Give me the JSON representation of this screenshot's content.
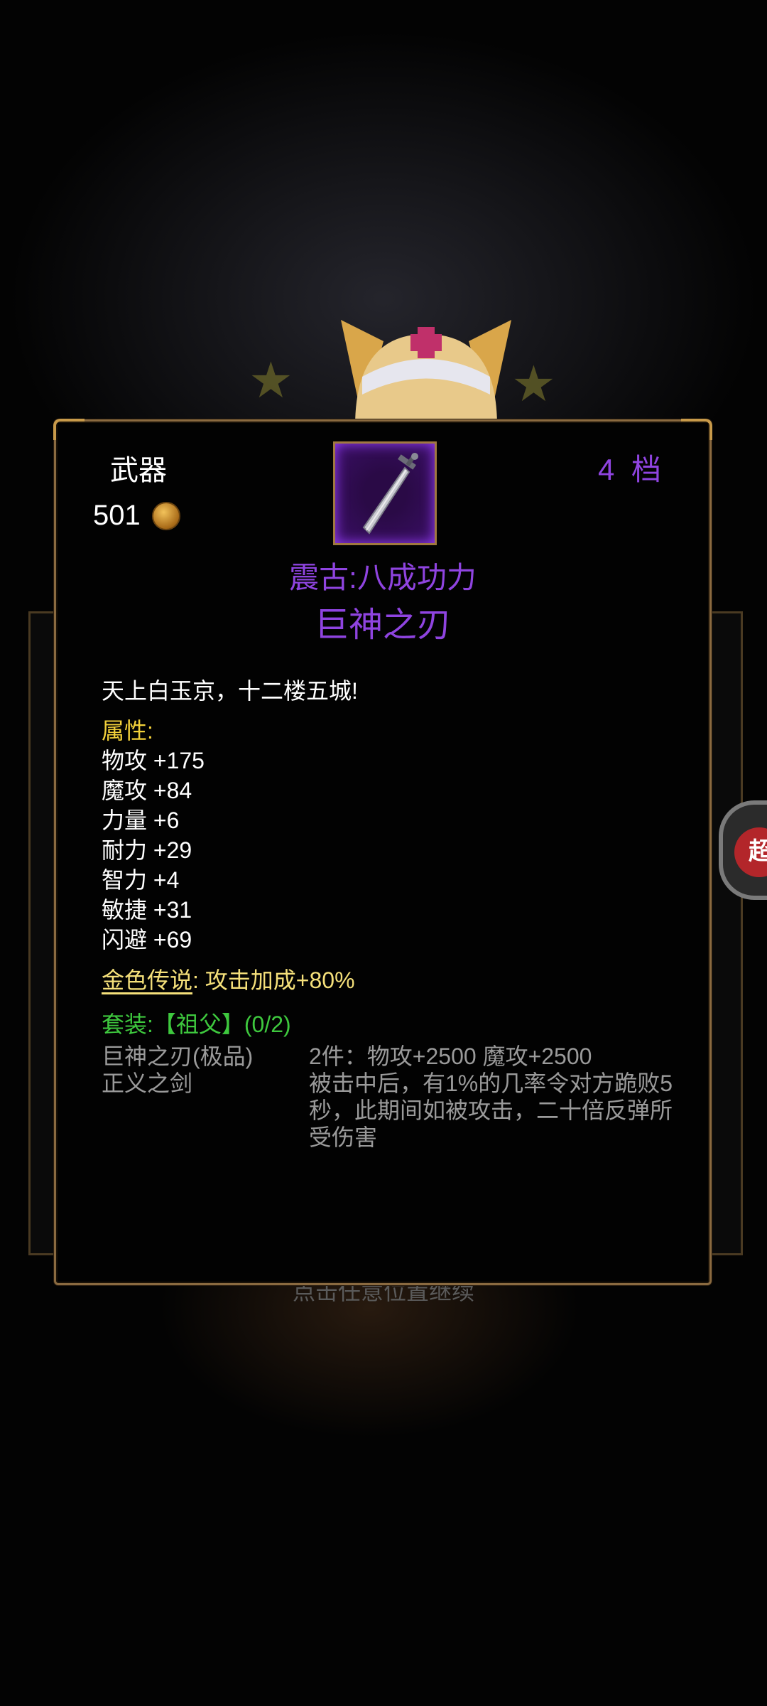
{
  "panel": {
    "category": "武器",
    "price": "501",
    "tier": "4 档",
    "subtitle": "震古:八成功力",
    "item_name": "巨神之刃",
    "flavor_text": "天上白玉京，十二楼五城!",
    "attributes_header": "属性:",
    "attributes": [
      "物攻 +175",
      "魔攻 +84",
      "力量 +6",
      "耐力 +29",
      "智力 +4",
      "敏捷 +31",
      "闪避 +69"
    ],
    "legendary": {
      "label": "金色传说",
      "separator": ":",
      "effect": "攻击加成+80%"
    },
    "set": {
      "header": "套装:【祖父】(0/2)",
      "pieces": [
        "巨神之刃(极品)",
        "正义之剑"
      ],
      "bonus_2pc": "2件：物攻+2500 魔攻+2500",
      "bonus_effect": "被击中后，有1%的几率令对方跪败5秒，此期间如被攻击，二十倍反弹所受伤害"
    }
  },
  "continue_hint": "点击任意位置继续",
  "float_button_label": "超",
  "colors": {
    "accent_purple": "#8f44e0",
    "attribute_header_yellow": "#f2d03a",
    "legendary_gold": "#f5e07a",
    "set_green": "#3ec83e",
    "muted_gray": "#9a9a9a",
    "border_gold": "#8a6a40"
  },
  "icons": {
    "item": "sword-icon",
    "currency": "gold-coin-icon"
  }
}
